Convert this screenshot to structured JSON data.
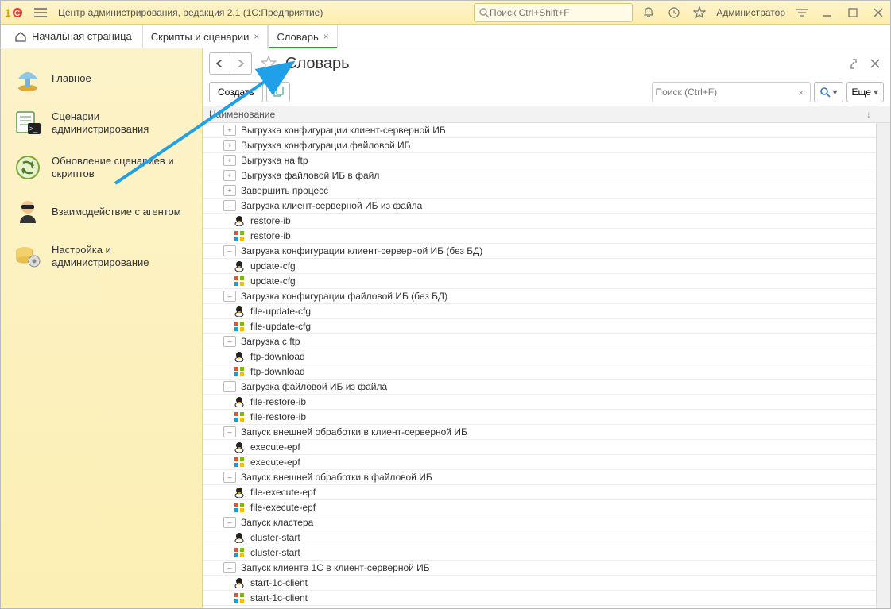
{
  "app": {
    "title": "Центр администрирования, редакция 2.1  (1С:Предприятие)",
    "search_placeholder": "Поиск Ctrl+Shift+F",
    "user": "Администратор"
  },
  "tabs": {
    "home": "Начальная страница",
    "items": [
      {
        "label": "Скрипты и сценарии",
        "active": false
      },
      {
        "label": "Словарь",
        "active": true
      }
    ]
  },
  "sidebar": {
    "items": [
      {
        "label": "Главное"
      },
      {
        "label": "Сценарии администрирования"
      },
      {
        "label": "Обновление сценариев и скриптов"
      },
      {
        "label": "Взаимодействие с агентом"
      },
      {
        "label": "Настройка и администрирование"
      }
    ]
  },
  "page": {
    "title": "Словарь",
    "create_label": "Создать",
    "search_placeholder": "Поиск (Ctrl+F)",
    "more_label": "Еще",
    "column_header": "Наименование"
  },
  "tree": [
    {
      "type": "group",
      "exp": "+",
      "label": "Выгрузка конфигурации клиент-серверной ИБ"
    },
    {
      "type": "group",
      "exp": "+",
      "label": "Выгрузка конфигурации файловой ИБ"
    },
    {
      "type": "group",
      "exp": "+",
      "label": "Выгрузка на ftp"
    },
    {
      "type": "group",
      "exp": "+",
      "label": "Выгрузка файловой ИБ в файл"
    },
    {
      "type": "group",
      "exp": "+",
      "label": "Завершить процесс"
    },
    {
      "type": "group",
      "exp": "-",
      "label": "Загрузка клиент-серверной ИБ из файла"
    },
    {
      "type": "child",
      "os": "linux",
      "label": "restore-ib"
    },
    {
      "type": "child",
      "os": "win",
      "label": "restore-ib"
    },
    {
      "type": "group",
      "exp": "-",
      "label": "Загрузка конфигурации клиент-серверной ИБ (без БД)"
    },
    {
      "type": "child",
      "os": "linux",
      "label": "update-cfg"
    },
    {
      "type": "child",
      "os": "win",
      "label": "update-cfg"
    },
    {
      "type": "group",
      "exp": "-",
      "label": "Загрузка конфигурации файловой ИБ (без БД)"
    },
    {
      "type": "child",
      "os": "linux",
      "label": "file-update-cfg"
    },
    {
      "type": "child",
      "os": "win",
      "label": "file-update-cfg"
    },
    {
      "type": "group",
      "exp": "-",
      "label": "Загрузка с ftp"
    },
    {
      "type": "child",
      "os": "linux",
      "label": "ftp-download"
    },
    {
      "type": "child",
      "os": "win",
      "label": "ftp-download"
    },
    {
      "type": "group",
      "exp": "-",
      "label": "Загрузка файловой ИБ из файла"
    },
    {
      "type": "child",
      "os": "linux",
      "label": "file-restore-ib"
    },
    {
      "type": "child",
      "os": "win",
      "label": "file-restore-ib"
    },
    {
      "type": "group",
      "exp": "-",
      "label": "Запуск внешней обработки в клиент-серверной ИБ"
    },
    {
      "type": "child",
      "os": "linux",
      "label": "execute-epf"
    },
    {
      "type": "child",
      "os": "win",
      "label": "execute-epf"
    },
    {
      "type": "group",
      "exp": "-",
      "label": "Запуск внешней обработки в файловой ИБ"
    },
    {
      "type": "child",
      "os": "linux",
      "label": "file-execute-epf"
    },
    {
      "type": "child",
      "os": "win",
      "label": "file-execute-epf"
    },
    {
      "type": "group",
      "exp": "-",
      "label": "Запуск кластера"
    },
    {
      "type": "child",
      "os": "linux",
      "label": "cluster-start"
    },
    {
      "type": "child",
      "os": "win",
      "label": "cluster-start"
    },
    {
      "type": "group",
      "exp": "-",
      "label": "Запуск клиента 1С в клиент-серверной ИБ"
    },
    {
      "type": "child",
      "os": "linux",
      "label": "start-1c-client"
    },
    {
      "type": "child",
      "os": "win",
      "label": "start-1c-client"
    }
  ]
}
